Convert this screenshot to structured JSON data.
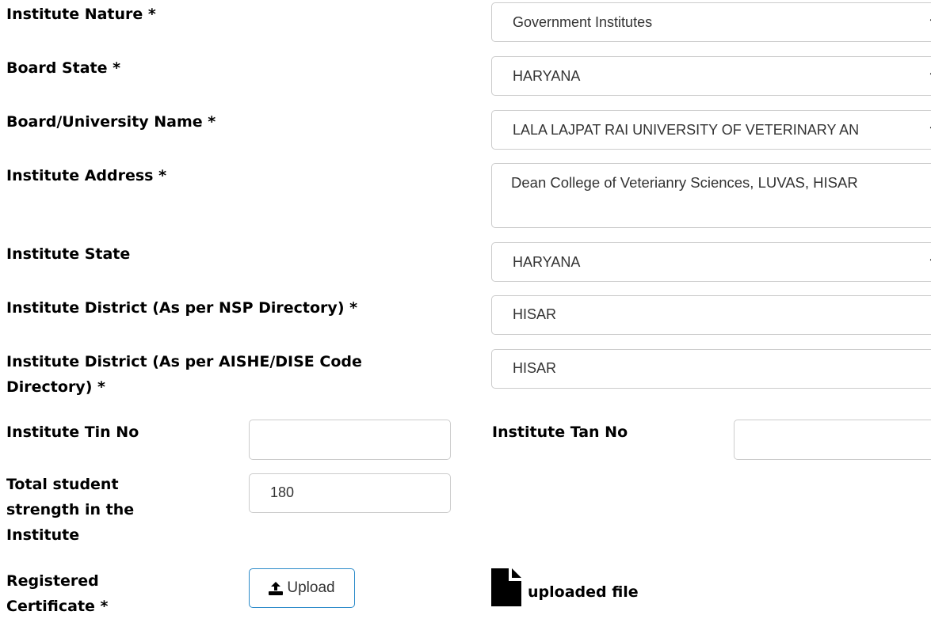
{
  "form": {
    "institute_nature": {
      "label": "Institute Nature *",
      "value": "Government Institutes"
    },
    "board_state": {
      "label": "Board State *",
      "value": "HARYANA"
    },
    "board_university": {
      "label": "Board/University Name *",
      "value": "LALA LAJPAT RAI UNIVERSITY OF VETERINARY AN"
    },
    "institute_address": {
      "label": "Institute Address *",
      "value": "Dean College of Veterianry Sciences, LUVAS, HISAR"
    },
    "institute_state": {
      "label": "Institute State",
      "value": "HARYANA"
    },
    "district_nsp": {
      "label": "Institute District (As per NSP Directory) *",
      "value": "HISAR"
    },
    "district_aishe_line1": "Institute District (As per AISHE/DISE Code",
    "district_aishe_line2": "Directory) *",
    "district_aishe_value": "HISAR",
    "tin": {
      "label": "Institute Tin No",
      "value": ""
    },
    "tan": {
      "label": "Institute Tan No",
      "value": ""
    },
    "strength_line1": "Total student",
    "strength_line2": "strength in the",
    "strength_line3": "Institute",
    "strength_value": "180",
    "cert_line1": "Registered",
    "cert_line2": "Certificate *",
    "upload_label": "Upload",
    "uploaded_file_label": "uploaded file"
  },
  "icons": {
    "select": "chevron-down-icon",
    "upload": "upload-icon",
    "file": "file-icon"
  }
}
